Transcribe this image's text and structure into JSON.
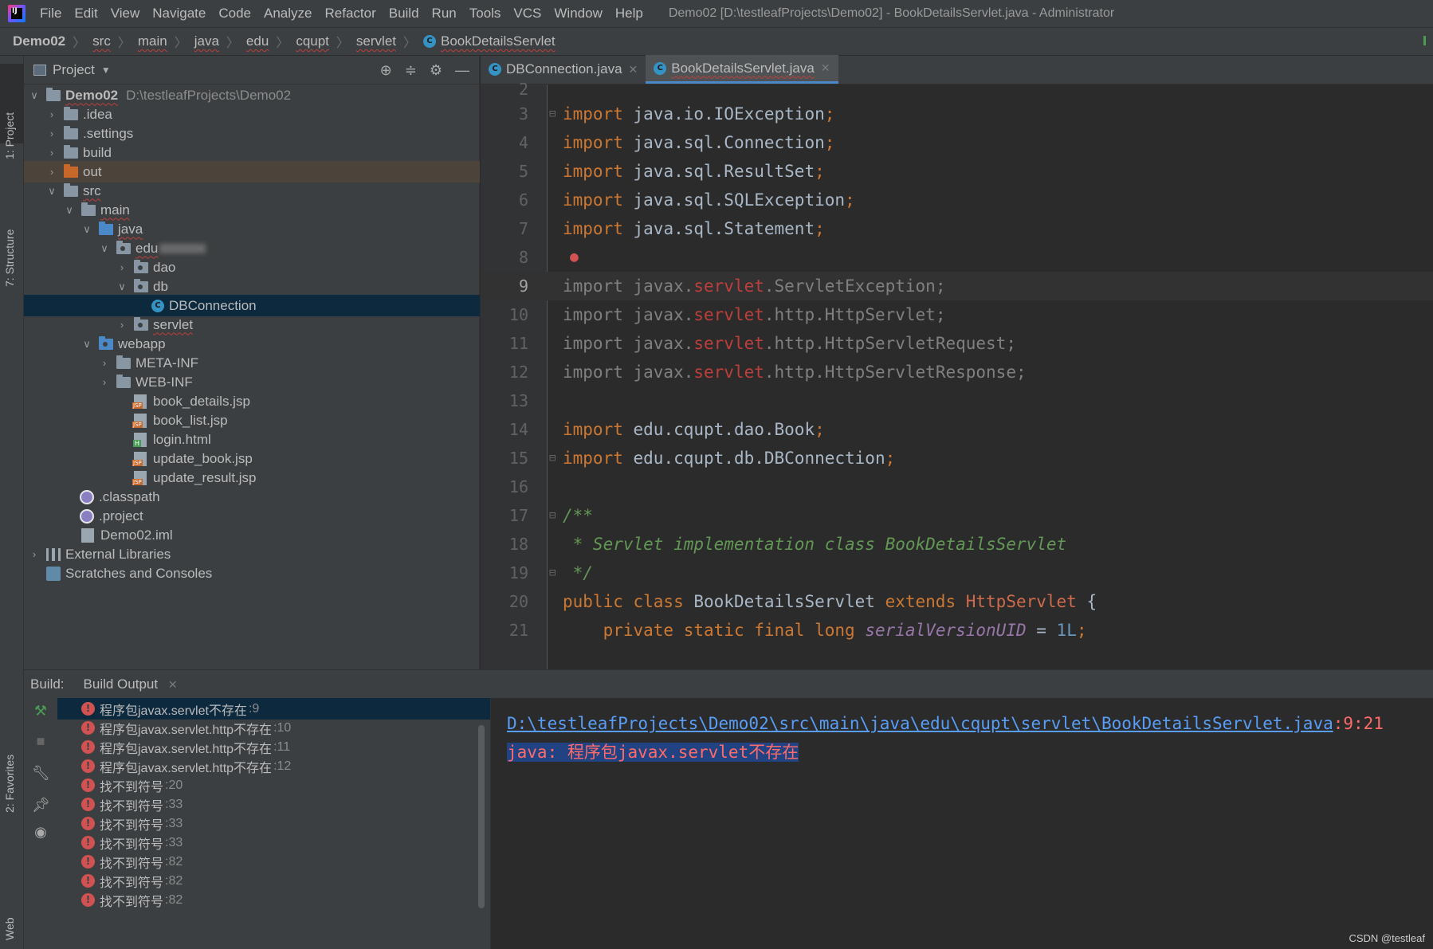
{
  "menubar": {
    "items": [
      "File",
      "Edit",
      "View",
      "Navigate",
      "Code",
      "Analyze",
      "Refactor",
      "Build",
      "Run",
      "Tools",
      "VCS",
      "Window",
      "Help"
    ],
    "window_title": "Demo02 [D:\\testleafProjects\\Demo02] - BookDetailsServlet.java - Administrator"
  },
  "breadcrumb": [
    "Demo02",
    "src",
    "main",
    "java",
    "edu",
    "cqupt",
    "servlet",
    "BookDetailsServlet"
  ],
  "left_stripe": {
    "project": "1: Project",
    "structure": "7: Structure",
    "favorites": "2: Favorites",
    "web": "Web"
  },
  "project_panel": {
    "title": "Project",
    "tree": [
      {
        "label": "Demo02",
        "extra": "D:\\testleafProjects\\Demo02"
      },
      {
        "label": ".idea"
      },
      {
        "label": ".settings"
      },
      {
        "label": "build"
      },
      {
        "label": "out"
      },
      {
        "label": "src"
      },
      {
        "label": "main"
      },
      {
        "label": "java"
      },
      {
        "label": "edu"
      },
      {
        "label": "dao"
      },
      {
        "label": "db"
      },
      {
        "label": "DBConnection"
      },
      {
        "label": "servlet"
      },
      {
        "label": "webapp"
      },
      {
        "label": "META-INF"
      },
      {
        "label": "WEB-INF"
      },
      {
        "label": "book_details.jsp"
      },
      {
        "label": "book_list.jsp"
      },
      {
        "label": "login.html"
      },
      {
        "label": "update_book.jsp"
      },
      {
        "label": "update_result.jsp"
      },
      {
        "label": ".classpath"
      },
      {
        "label": ".project"
      },
      {
        "label": "Demo02.iml"
      },
      {
        "label": "External Libraries"
      },
      {
        "label": "Scratches and Consoles"
      }
    ]
  },
  "editor": {
    "tabs": [
      "DBConnection.java",
      "BookDetailsServlet.java"
    ],
    "line_numbers": [
      "2",
      "3",
      "4",
      "5",
      "6",
      "7",
      "8",
      "9",
      "10",
      "11",
      "12",
      "13",
      "14",
      "15",
      "16",
      "17",
      "18",
      "19",
      "20",
      "21"
    ]
  },
  "build": {
    "label": "Build:",
    "tab": "Build Output",
    "errors": [
      {
        "msg": "程序包javax.servlet不存在",
        "line": ":9"
      },
      {
        "msg": "程序包javax.servlet.http不存在",
        "line": ":10"
      },
      {
        "msg": "程序包javax.servlet.http不存在",
        "line": ":11"
      },
      {
        "msg": "程序包javax.servlet.http不存在",
        "line": ":12"
      },
      {
        "msg": "找不到符号",
        "line": ":20"
      },
      {
        "msg": "找不到符号",
        "line": ":33"
      },
      {
        "msg": "找不到符号",
        "line": ":33"
      },
      {
        "msg": "找不到符号",
        "line": ":33"
      },
      {
        "msg": "找不到符号",
        "line": ":82"
      },
      {
        "msg": "找不到符号",
        "line": ":82"
      },
      {
        "msg": "找不到符号",
        "line": ":82"
      }
    ],
    "output_path": "D:\\testleafProjects\\Demo02\\src\\main\\java\\edu\\cqupt\\servlet\\BookDetailsServlet.java",
    "output_pos": ":9:21",
    "output_message": "java: 程序包javax.servlet不存在"
  },
  "watermark": "CSDN @testleaf"
}
